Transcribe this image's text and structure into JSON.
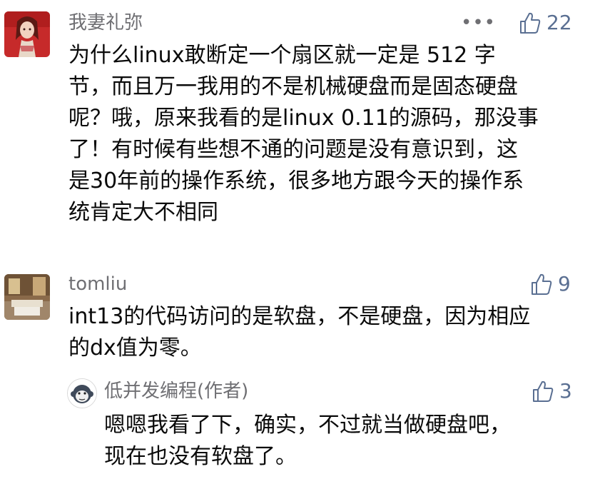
{
  "comments": [
    {
      "author": "我妻礼弥",
      "more_label": "•••",
      "likes": "22",
      "text": "为什么linux敢断定一个扇区就一定是 512 字\n节，而且万一我用的不是机械硬盘而是固态硬盘\n呢？哦，原来我看的是linux 0.11的源码，那没事\n了！有时候有些想不通的问题是没有意识到，这\n是30年前的操作系统，很多地方跟今天的操作系\n统肯定大不相同",
      "avatar_icon": "user-avatar-anime-icon"
    },
    {
      "author": "tomliu",
      "likes": "9",
      "text": "int13的代码访问的是软盘，不是硬盘，因为相应\n的dx值为零。",
      "avatar_icon": "user-avatar-room-icon",
      "reply": {
        "author": "低并发编程(作者)",
        "likes": "3",
        "text": "嗯嗯我看了下，确实，不过就当做硬盘吧，\n现在也没有软盘了。",
        "avatar_icon": "author-avatar-monkey-icon"
      }
    }
  ],
  "colors": {
    "meta_text": "#6f6f73",
    "like_accent": "#5a6f92",
    "body_text": "#0a0a0a"
  },
  "like_icon": "thumbs-up-icon"
}
